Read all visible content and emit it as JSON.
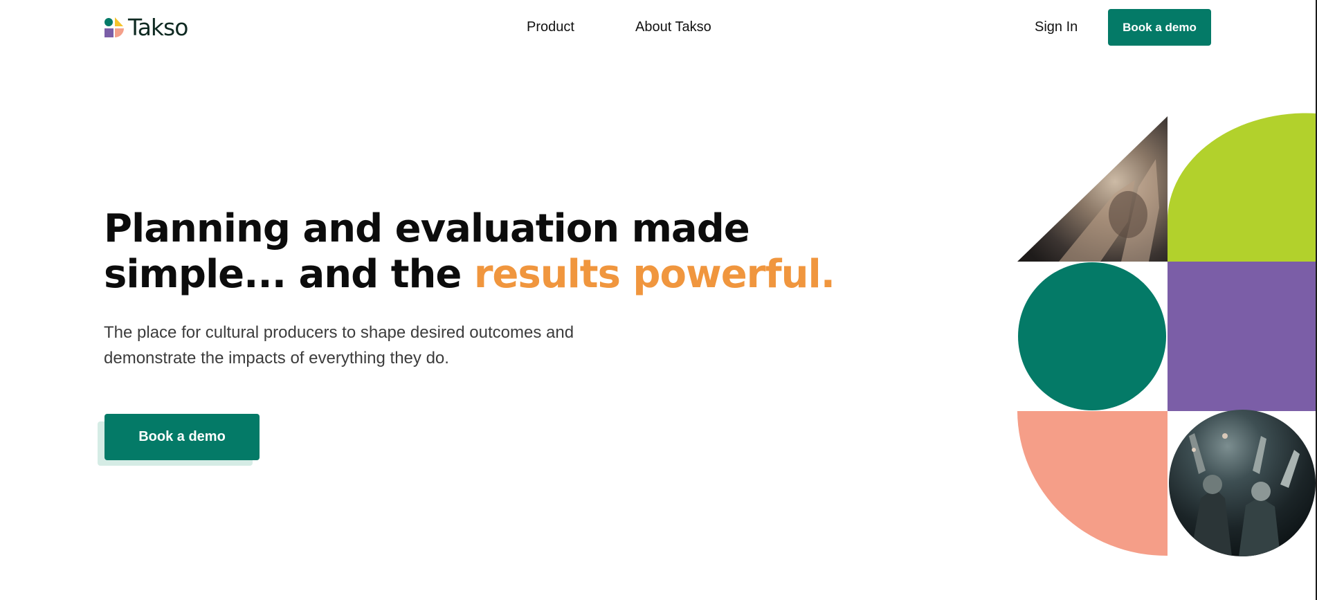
{
  "brand": {
    "name": "Takso",
    "logo_colors": [
      "#047a67",
      "#f5c42c",
      "#7b5ea7",
      "#f4a08a"
    ]
  },
  "nav": {
    "items": [
      {
        "label": "Product"
      },
      {
        "label": "About Takso"
      }
    ],
    "sign_in": "Sign In",
    "cta": "Book a demo"
  },
  "hero": {
    "headline_line1": "Planning and evaluation made",
    "headline_line2_prefix": "simple... and the ",
    "headline_accent": "results powerful.",
    "subtext": "The place for cultural producers to shape desired outcomes and demonstrate the impacts of everything they do.",
    "cta": "Book a demo"
  },
  "colors": {
    "primary": "#047a67",
    "accent": "#f0963e",
    "lime": "#b2d12c",
    "purple": "#7b5ea7",
    "salmon": "#f59e88"
  },
  "art": {
    "tiles": [
      "photo-hands-triangle",
      "lime-quarter-circle",
      "teal-circle",
      "purple-square",
      "salmon-quarter-circle",
      "photo-concert-crowd-circle"
    ]
  }
}
